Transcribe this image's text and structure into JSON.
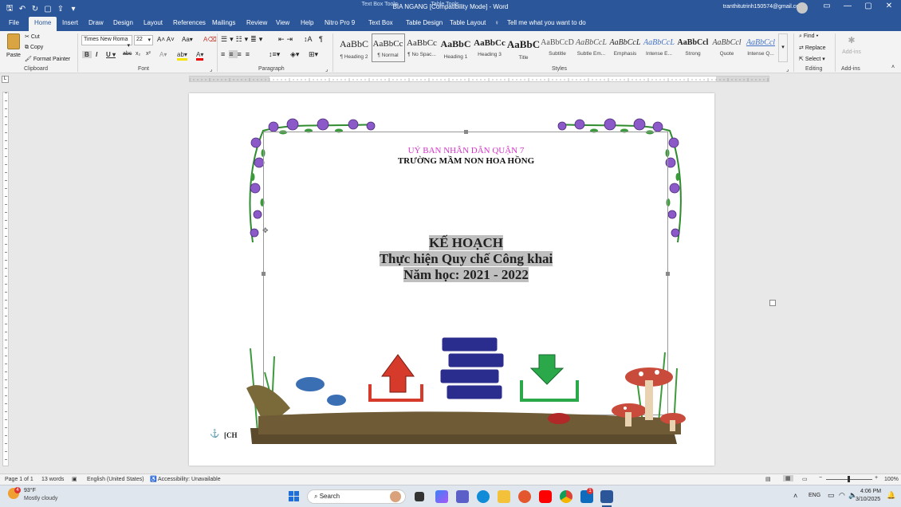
{
  "titlebar": {
    "doc_title": "BÌA NGANG [Compatibility Mode]  -  Word",
    "context1": "Text Box Tools",
    "context2": "Table Tools",
    "user": "tranthitutrinh150574@gmail.com"
  },
  "tabs": [
    "File",
    "Home",
    "Insert",
    "Draw",
    "Design",
    "Layout",
    "References",
    "Mailings",
    "Review",
    "View",
    "Help",
    "Nitro Pro 9",
    "Text Box",
    "Table Design",
    "Table Layout"
  ],
  "tell_me": "Tell me what you want to do",
  "clipboard": {
    "paste": "Paste",
    "cut": "Cut",
    "copy": "Copy",
    "format_painter": "Format Painter",
    "label": "Clipboard"
  },
  "font": {
    "name": "Times New Roma",
    "size": "22",
    "label": "Font"
  },
  "paragraph_label": "Paragraph",
  "styles": {
    "label": "Styles",
    "items": [
      {
        "preview": "AaBbC",
        "name": "¶ Heading 2"
      },
      {
        "preview": "AaBbCc",
        "name": "¶ Normal"
      },
      {
        "preview": "AaBbCc",
        "name": "¶ No Spac..."
      },
      {
        "preview": "AaBbC",
        "name": "Heading 1"
      },
      {
        "preview": "AaBbCc",
        "name": "Heading 3"
      },
      {
        "preview": "AaBbC",
        "name": "Title"
      },
      {
        "preview": "AaBbCcD",
        "name": "Subtitle"
      },
      {
        "preview": "AaBbCcL",
        "name": "Subtle Em..."
      },
      {
        "preview": "AaBbCcL",
        "name": "Emphasis"
      },
      {
        "preview": "AaBbCcL",
        "name": "Intense E..."
      },
      {
        "preview": "AaBbCcl",
        "name": "Strong"
      },
      {
        "preview": "AaBbCcl",
        "name": "Quote"
      },
      {
        "preview": "AaBbCcl",
        "name": "Intense Q..."
      }
    ]
  },
  "editing": {
    "find": "Find",
    "replace": "Replace",
    "select": "Select",
    "label": "Editing"
  },
  "addins": {
    "button": "Add-ins",
    "label": "Add-ins"
  },
  "document": {
    "line1": "UỶ BAN NHÂN DÂN QUẬN 7",
    "line2": "TRƯỜNG MẦM NON HOA HỒNG",
    "heading1": "KẾ HOẠCH",
    "heading2": "Thực hiện Quy chế Công khai",
    "heading3": "Năm học: 2021 - 2022",
    "bottom_text": "[CH"
  },
  "status": {
    "page": "Page 1 of 1",
    "words": "13 words",
    "language": "English (United States)",
    "accessibility": "Accessibility: Unavailable",
    "zoom": "100%"
  },
  "taskbar": {
    "weather_temp": "93°F",
    "weather_desc": "Mostly cloudy",
    "search": "Search",
    "lang": "ENG",
    "time": "4:06 PM",
    "date": "3/10/2025",
    "notif_badge": "4",
    "outlook_badge": "1"
  },
  "colors": {
    "word_blue": "#2b579a",
    "line1_color": "#d535c8"
  }
}
